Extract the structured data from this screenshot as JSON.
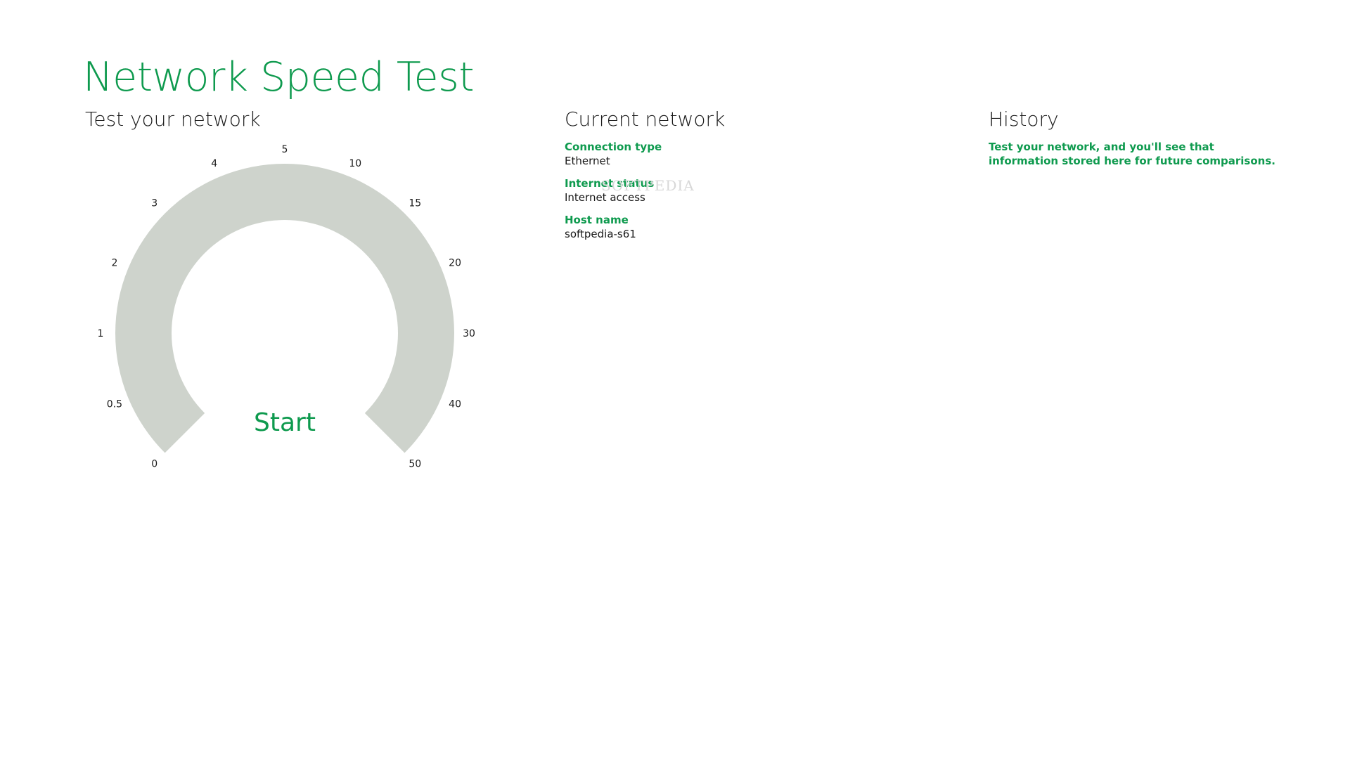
{
  "app": {
    "title": "Network Speed Test"
  },
  "colors": {
    "accent": "#0e9a4e",
    "gauge_track": "#ced3cc",
    "text": "#1a1a1a",
    "background": "#ffffff"
  },
  "test_section": {
    "title": "Test your network",
    "start_label": "Start",
    "gauge_ticks": [
      "0",
      "0.5",
      "1",
      "2",
      "3",
      "4",
      "5",
      "10",
      "15",
      "20",
      "30",
      "40",
      "50"
    ]
  },
  "network_section": {
    "title": "Current network",
    "fields": [
      {
        "label": "Connection type",
        "value": "Ethernet"
      },
      {
        "label": "Internet status",
        "value": "Internet access"
      },
      {
        "label": "Host name",
        "value": "softpedia-s61"
      }
    ]
  },
  "history_section": {
    "title": "History",
    "empty_message": "Test your network, and you'll see that information stored here for future comparisons."
  },
  "watermark": "SOFTPEDIA"
}
